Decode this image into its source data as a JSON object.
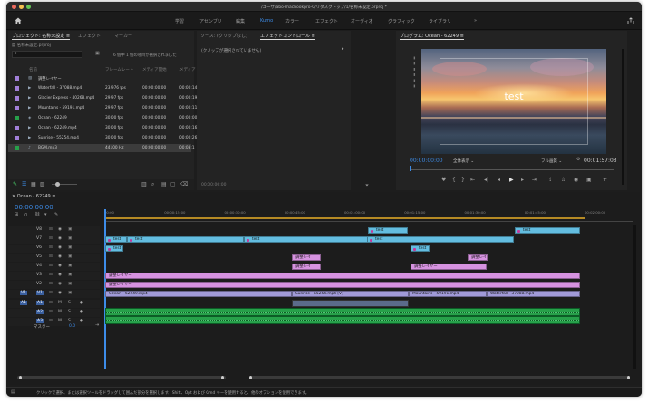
{
  "window_title": "/ユーザ/abo-macbookpro-0/リダスクトップ/1/名称未設定.prproj *",
  "workspaces": {
    "home_icon": "home-icon",
    "tabs": [
      "学習",
      "アセンブリ",
      "編集",
      "Kumo",
      "カラー",
      "エフェクト",
      "オーディオ",
      "グラフィック",
      "ライブラリ"
    ],
    "active": "Kumo",
    "more": "»",
    "share_icon": "share-icon"
  },
  "project_panel": {
    "tabs": [
      "プロジェクト: 名称未設定",
      "エフェクト",
      "マーカー"
    ],
    "active_tab": "プロジェクト: 名称未設定",
    "menu_glyph": "≡",
    "file_name": "名称未設定.prproj",
    "search_placeholder": "",
    "selection_info": "6 個中 1 個の項目が選択されました",
    "columns": [
      "名前",
      "フレームレート",
      "メディア開始",
      "メディア"
    ],
    "items": [
      {
        "name": "調整レイヤー",
        "fps": "",
        "start": "",
        "end": "",
        "color": "#a17fd8",
        "kind": "adjust"
      },
      {
        "name": "Waterfall - 37088.mp4",
        "fps": "23.976 fps",
        "start": "00:00:00:00",
        "end": "00:00:14",
        "color": "#a17fd8",
        "kind": "video"
      },
      {
        "name": "Glacier Express - 40268.mp4",
        "fps": "29.97 fps",
        "start": "00:00:00:00",
        "end": "00:00:19",
        "color": "#a17fd8",
        "kind": "video"
      },
      {
        "name": "Mountains - 59191.mp4",
        "fps": "29.97 fps",
        "start": "00:00:00:00",
        "end": "00:00:11",
        "color": "#a17fd8",
        "kind": "video"
      },
      {
        "name": "Ocean - 62249",
        "fps": "30.00 fps",
        "start": "00:00:00:00",
        "end": "00:00:00",
        "color": "#27a04a",
        "kind": "sequence"
      },
      {
        "name": "Ocean - 62249.mp4",
        "fps": "30.00 fps",
        "start": "00:00:00:00",
        "end": "00:00:16",
        "color": "#a17fd8",
        "kind": "video"
      },
      {
        "name": "Sunrise - 55254.mp4",
        "fps": "30.00 fps",
        "start": "00:00:00:00",
        "end": "00:00:26",
        "color": "#a17fd8",
        "kind": "video"
      },
      {
        "name": "BGM.mp3",
        "fps": "44100 Hz",
        "start": "00:00:00:00",
        "end": "00:03:1",
        "color": "#27a04a",
        "kind": "audio"
      }
    ]
  },
  "effects_panel": {
    "tabs": [
      "ソース: (クリップなし)",
      "エフェクトコントロール"
    ],
    "active_tab": "エフェクトコントロール",
    "menu_glyph": "≡",
    "empty_message": "(クリップが選択されていません)",
    "timecode": "00:00:00:00"
  },
  "program_monitor": {
    "title": "プログラム: Ocean - 62249",
    "menu_glyph": "≡",
    "overlay_text": "test",
    "timecode": "00:00:00:00",
    "fit": "全体表示",
    "resolution": "フル画質",
    "duration": "00:01:57:03"
  },
  "timeline": {
    "tab": "Ocean - 62249",
    "menu_glyph": "≡",
    "timecode": "00:00:00:00",
    "ruler": [
      "00:00",
      "00:00:15:00",
      "00:00:30:00",
      "00:00:45:00",
      "00:01:00:00",
      "00:01:15:00",
      "00:01:30:00",
      "00:01:45:00",
      "00:02:00:00"
    ],
    "video_tracks": [
      "V8",
      "V7",
      "V6",
      "V5",
      "V4",
      "V3",
      "V2",
      "V1"
    ],
    "audio_tracks": [
      "A1",
      "A2",
      "A3"
    ],
    "master_label": "マスター",
    "master_value": "0.0",
    "clips": {
      "test": "test",
      "adjust": "調整レイヤー",
      "adjust_short": "調整レイ",
      "ocean": "Ocean - 62249.mp4",
      "sunrise": "Sunrise - 55254.mp4 [V]",
      "mountains": "Mountains - 59191.mp4",
      "waterfall": "Waterfall - 37088.mp4"
    }
  },
  "status_bar": "クリックで選択、または選択ツールをドラッグして囲んだ部分を選択します。Shift、Opt および Cmd キーを使用すると、他のオプションを使用できます。",
  "colors": {
    "accent": "#3d8ce8",
    "video_clip": "#63bde0",
    "adjust_clip": "#d692e0",
    "video_main": "#a19ad8",
    "audio_clip": "#27a04a",
    "playhead": "#3d8ce8"
  }
}
